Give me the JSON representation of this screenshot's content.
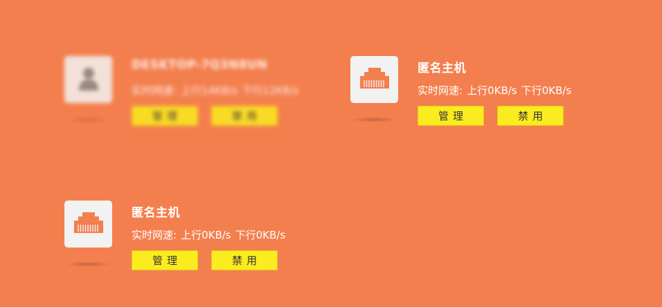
{
  "colors": {
    "background": "#f47f4e",
    "button": "#fbec1f",
    "icon_box": "#f2f2f2",
    "icon_orange": "#f47f4e"
  },
  "devices": [
    {
      "name": "DESKTOP-7Q3N8UN",
      "speed_label": "实时网速:",
      "upload": "上行14KB/s",
      "download": "下行12KB/s",
      "manage_label": "管理",
      "disable_label": "禁用",
      "icon": "user-avatar-icon",
      "blurred": true
    },
    {
      "name": "匿名主机",
      "speed_label": "实时网速:",
      "upload": "上行0KB/s",
      "download": "下行0KB/s",
      "manage_label": "管理",
      "disable_label": "禁用",
      "icon": "ethernet-port-icon",
      "blurred": false
    },
    {
      "name": "匿名主机",
      "speed_label": "实时网速:",
      "upload": "上行0KB/s",
      "download": "下行0KB/s",
      "manage_label": "管理",
      "disable_label": "禁用",
      "icon": "ethernet-port-icon",
      "blurred": false
    }
  ]
}
